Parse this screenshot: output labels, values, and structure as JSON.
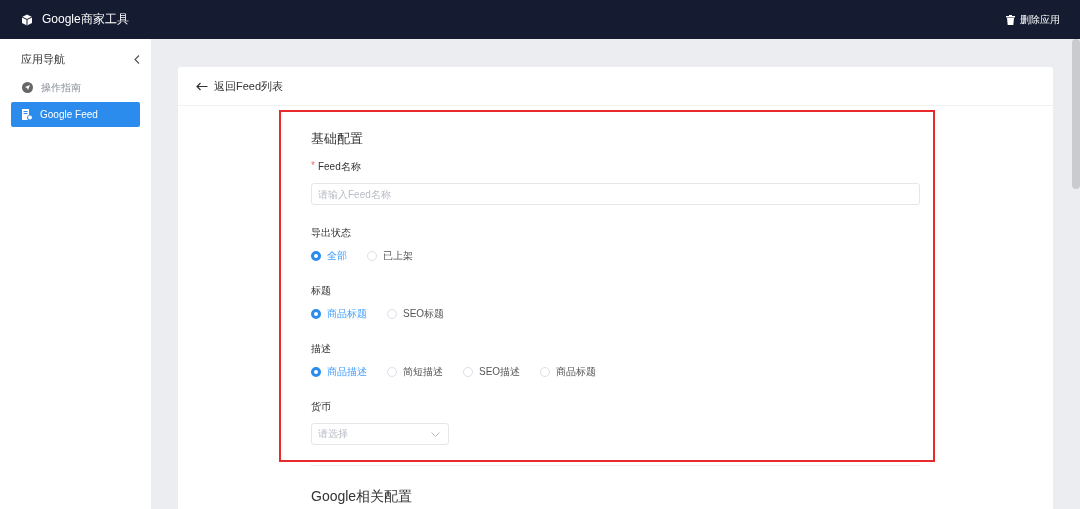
{
  "app": {
    "title": "Google商家工具",
    "delete_button": "删除应用"
  },
  "sidebar": {
    "title": "应用导航",
    "items": [
      {
        "label": "操作指南",
        "selected": false
      },
      {
        "label": "Google Feed",
        "selected": true
      }
    ]
  },
  "card": {
    "back_link": "返回Feed列表",
    "sections": [
      {
        "title": "基础配置",
        "highlighted": true,
        "fields": [
          {
            "kind": "text",
            "required_mark": "*",
            "label": "Feed名称",
            "placeholder": "请输入Feed名称"
          },
          {
            "kind": "radio",
            "label": "导出状态",
            "options": [
              {
                "label": "全部",
                "selected": true
              },
              {
                "label": "已上架",
                "selected": false
              }
            ]
          },
          {
            "kind": "radio",
            "label": "标题",
            "options": [
              {
                "label": "商品标题",
                "selected": true
              },
              {
                "label": "SEO标题",
                "selected": false
              }
            ]
          },
          {
            "kind": "radio",
            "label": "描述",
            "options": [
              {
                "label": "商品描述",
                "selected": true
              },
              {
                "label": "简短描述",
                "selected": false
              },
              {
                "label": "SEO描述",
                "selected": false
              },
              {
                "label": "商品标题",
                "selected": false
              }
            ]
          },
          {
            "kind": "select",
            "label": "货币",
            "placeholder": "请选择"
          }
        ]
      },
      {
        "title": "Google相关配置",
        "highlighted": false
      }
    ]
  }
}
